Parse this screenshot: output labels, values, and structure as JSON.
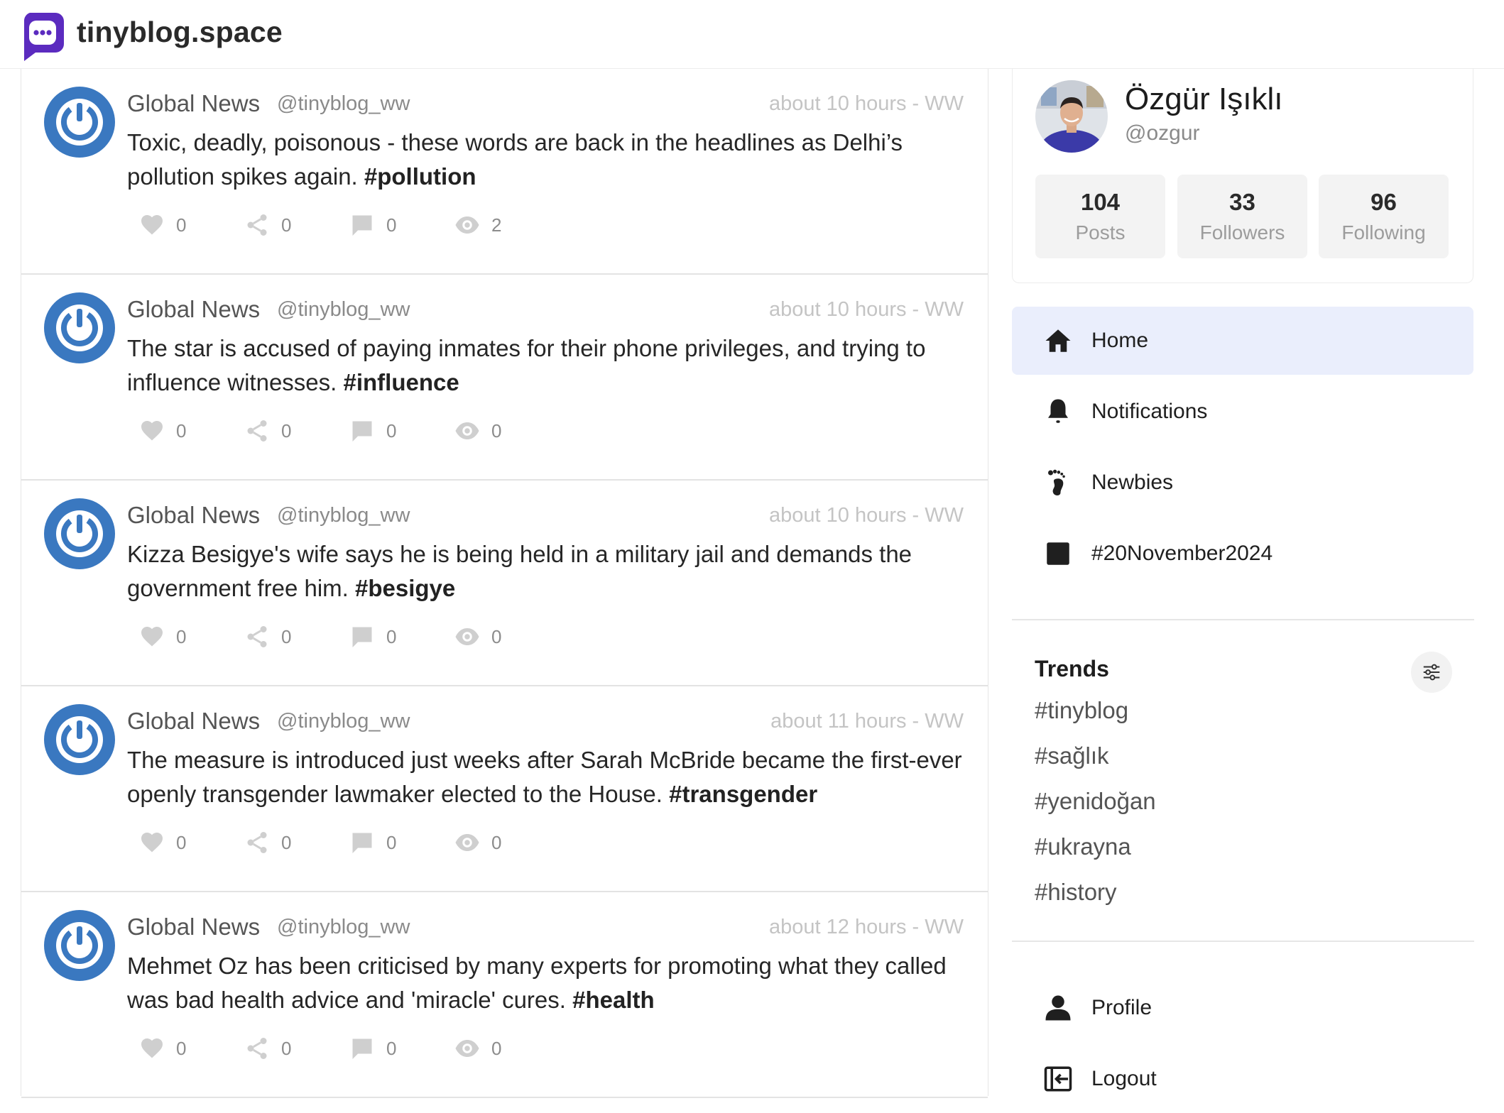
{
  "app": {
    "brand": "tinyblog.space",
    "accent": "#5b2bbf"
  },
  "posts": [
    {
      "author": "Global News",
      "handle": "@tinyblog_ww",
      "time": "about 10 hours - WW",
      "text": "Toxic, deadly, poisonous - these words are back in the headlines as Delhi’s pollution spikes again.",
      "tag": "#pollution",
      "likes": "0",
      "shares": "0",
      "comments": "0",
      "views": "2"
    },
    {
      "author": "Global News",
      "handle": "@tinyblog_ww",
      "time": "about 10 hours - WW",
      "text": "The star is accused of paying inmates for their phone privileges, and trying to influence witnesses.",
      "tag": "#influence",
      "likes": "0",
      "shares": "0",
      "comments": "0",
      "views": "0"
    },
    {
      "author": "Global News",
      "handle": "@tinyblog_ww",
      "time": "about 10 hours - WW",
      "text": "Kizza Besigye's wife says he is being held in a military jail and demands the government free him.",
      "tag": "#besigye",
      "likes": "0",
      "shares": "0",
      "comments": "0",
      "views": "0"
    },
    {
      "author": "Global News",
      "handle": "@tinyblog_ww",
      "time": "about 11 hours - WW",
      "text": "The measure is introduced just weeks after Sarah McBride became the first-ever openly transgender lawmaker elected to the House.",
      "tag": "#transgender",
      "likes": "0",
      "shares": "0",
      "comments": "0",
      "views": "0"
    },
    {
      "author": "Global News",
      "handle": "@tinyblog_ww",
      "time": "about 12 hours - WW",
      "text": "Mehmet Oz has been criticised by many experts for promoting what they called was bad health advice and 'miracle' cures.",
      "tag": "#health",
      "likes": "0",
      "shares": "0",
      "comments": "0",
      "views": "0"
    }
  ],
  "profile": {
    "name": "Özgür Işıklı",
    "handle": "@ozgur",
    "stats": [
      {
        "value": "104",
        "label": "Posts"
      },
      {
        "value": "33",
        "label": "Followers"
      },
      {
        "value": "96",
        "label": "Following"
      }
    ]
  },
  "nav": [
    {
      "label": "Home",
      "icon": "home-icon",
      "active": true
    },
    {
      "label": "Notifications",
      "icon": "bell-icon"
    },
    {
      "label": "Newbies",
      "icon": "footprint-icon"
    },
    {
      "label": "#20November2024",
      "icon": "square-icon"
    }
  ],
  "trends": {
    "title": "Trends",
    "items": [
      "#tinyblog",
      "#sağlık",
      "#yenidoğan",
      "#ukrayna",
      "#history"
    ]
  },
  "account": [
    {
      "label": "Profile",
      "icon": "user-icon"
    },
    {
      "label": "Logout",
      "icon": "logout-icon"
    }
  ]
}
